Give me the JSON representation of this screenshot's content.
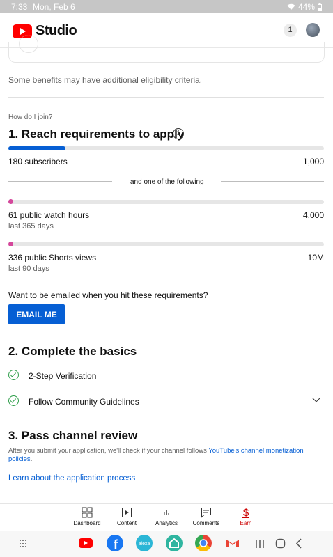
{
  "status_bar": {
    "time": "7:33",
    "date": "Mon, Feb 6",
    "battery": "44%"
  },
  "header": {
    "app_name": "Studio",
    "notification_count": "1"
  },
  "benefits_note": "Some benefits may have additional eligibility criteria.",
  "join": {
    "how_label": "How do I join?",
    "step1": {
      "title": "1. Reach requirements to apply",
      "info_icon": "i",
      "subscribers": {
        "current": "180 subscribers",
        "target": "1,000",
        "progress": 0.18
      },
      "divider_text": "and one of the following",
      "watch_hours": {
        "current": "61 public watch hours",
        "target": "4,000",
        "period": "last 365 days",
        "progress": 0.015
      },
      "shorts_views": {
        "current": "336 public Shorts views",
        "target": "10M",
        "period": "last 90 days",
        "progress": 0.0
      },
      "email_prompt": "Want to be emailed when you hit these requirements?",
      "email_button": "EMAIL ME"
    },
    "step2": {
      "title": "2. Complete the basics",
      "items": [
        "2-Step Verification",
        "Follow Community Guidelines"
      ]
    },
    "step3": {
      "title": "3. Pass channel review",
      "description": "After you submit your application, we'll check if your channel follows ",
      "description_link": "YouTube's channel monetization policies",
      "description_end": ".",
      "learn_link": "Learn about the application process"
    }
  },
  "bottom_nav": {
    "items": [
      {
        "label": "Dashboard",
        "icon": "dashboard-icon"
      },
      {
        "label": "Content",
        "icon": "content-icon"
      },
      {
        "label": "Analytics",
        "icon": "analytics-icon"
      },
      {
        "label": "Comments",
        "icon": "comments-icon"
      },
      {
        "label": "Earn",
        "icon": "earn-icon"
      }
    ]
  },
  "colors": {
    "accent": "#065fd4",
    "progress_blue": "#065fd4",
    "progress_pink": "#d4479b",
    "success": "#2e9e4a",
    "earn_red": "#cc0000"
  }
}
